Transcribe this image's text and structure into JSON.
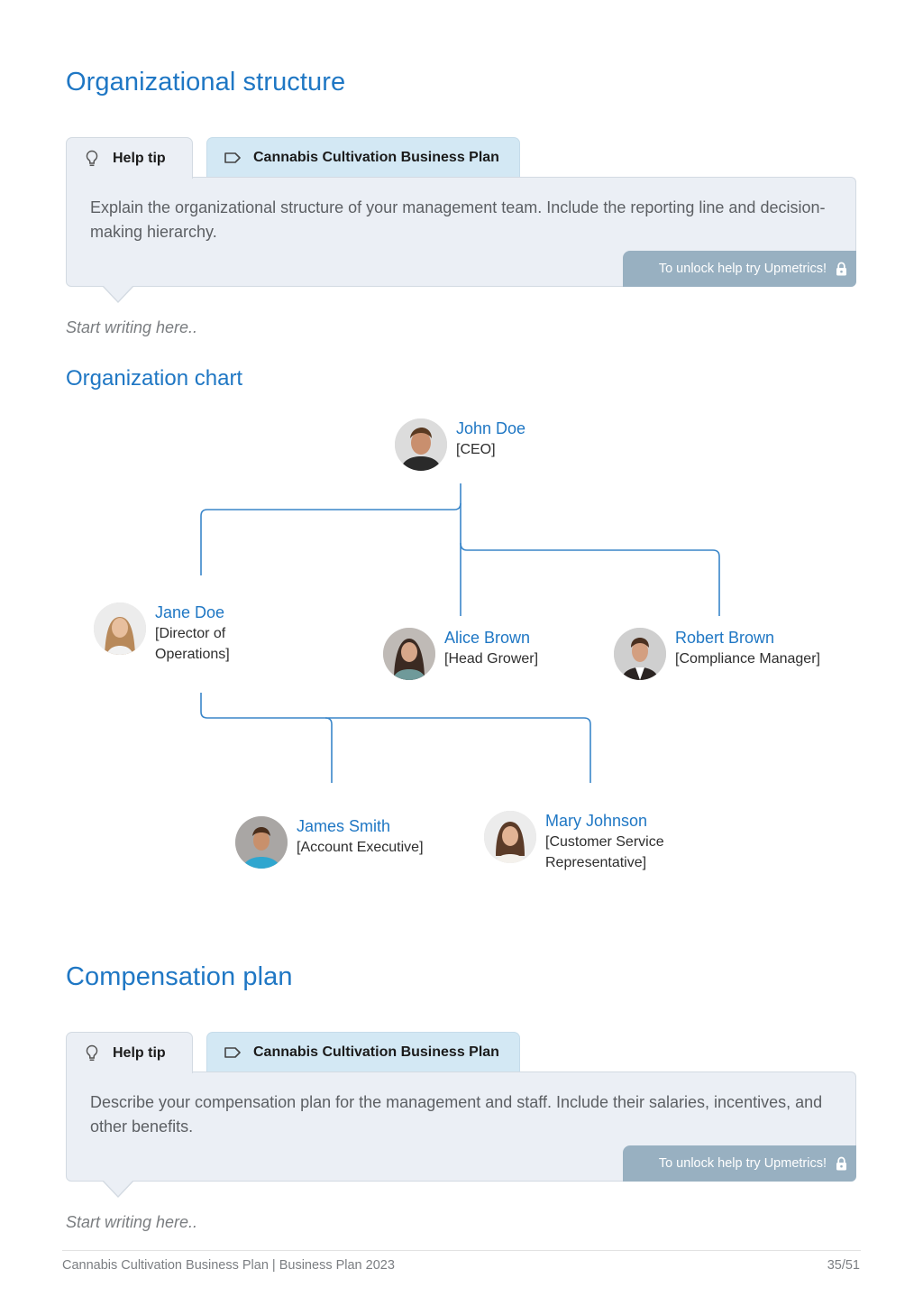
{
  "sections": {
    "org_structure": {
      "title": "Organizational structure",
      "help_tab_label": "Help tip",
      "plan_tab_label": "Cannabis Cultivation Business Plan",
      "help_text": "Explain the organizational structure of your management team. Include the reporting line and decision-making hierarchy.",
      "unlock_label": "To unlock help try Upmetrics!",
      "placeholder": "Start writing here.."
    },
    "org_chart": {
      "title": "Organization chart",
      "line_color": "#1f77c4",
      "people": [
        {
          "name": "John Doe",
          "role": "[CEO]",
          "reports_to": null
        },
        {
          "name": "Jane Doe",
          "role": "[Director of Operations]",
          "reports_to": "John Doe"
        },
        {
          "name": "Alice Brown",
          "role": "[Head Grower]",
          "reports_to": "John Doe"
        },
        {
          "name": "Robert Brown",
          "role": "[Compliance Manager]",
          "reports_to": "John Doe"
        },
        {
          "name": "James Smith",
          "role": "[Account Executive]",
          "reports_to": "Jane Doe"
        },
        {
          "name": "Mary Johnson",
          "role": "[Customer Service Representative]",
          "reports_to": "Jane Doe"
        }
      ]
    },
    "compensation": {
      "title": "Compensation plan",
      "help_tab_label": "Help tip",
      "plan_tab_label": "Cannabis Cultivation Business Plan",
      "help_text": "Describe your compensation plan for the management and staff. Include their salaries, incentives, and other benefits.",
      "unlock_label": "To unlock help try Upmetrics!",
      "placeholder": "Start writing here.."
    }
  },
  "icons": {
    "help": "lightbulb-icon",
    "plan": "tag-icon",
    "unlock": "lock-icon"
  },
  "colors": {
    "accent": "#1f77c4",
    "help_panel_bg": "#ebeff5",
    "plan_tab_bg": "#d3e8f4",
    "unlock_bg": "#98b0c1"
  },
  "footer": {
    "document": "Cannabis Cultivation Business Plan | Business Plan 2023",
    "page": "35/51"
  }
}
